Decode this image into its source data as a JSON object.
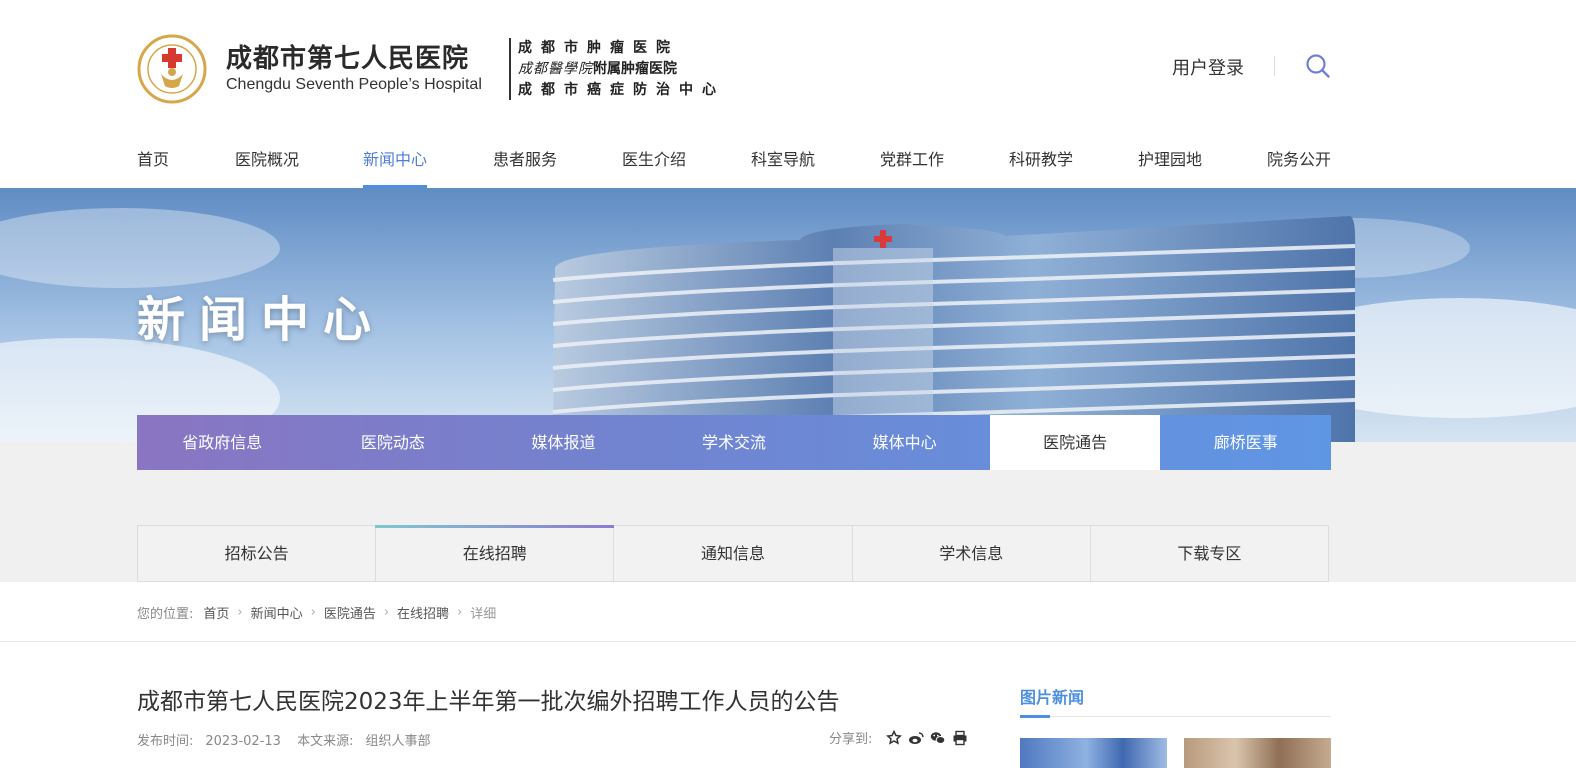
{
  "header": {
    "logo_name": "成都市第七人民医院",
    "logo_en": "Chengdu Seventh People’s Hospital",
    "logo_right_line1": "成都市肿瘤医院",
    "logo_right_line2_script": "成都醫學院",
    "logo_right_line2": "附属肿瘤医院",
    "logo_right_line3": "成都市癌症防治中心",
    "login": "用户登录"
  },
  "nav": [
    {
      "label": "首页"
    },
    {
      "label": "医院概况"
    },
    {
      "label": "新闻中心",
      "active": true
    },
    {
      "label": "患者服务"
    },
    {
      "label": "医生介绍"
    },
    {
      "label": "科室导航"
    },
    {
      "label": "党群工作"
    },
    {
      "label": "科研教学"
    },
    {
      "label": "护理园地"
    },
    {
      "label": "院务公开"
    }
  ],
  "banner": {
    "title": "新闻中心"
  },
  "section_tabs": [
    {
      "label": "省政府信息"
    },
    {
      "label": "医院动态"
    },
    {
      "label": "媒体报道"
    },
    {
      "label": "学术交流"
    },
    {
      "label": "媒体中心"
    },
    {
      "label": "医院通告",
      "active": true
    },
    {
      "label": "廊桥医事"
    }
  ],
  "sub_tabs": [
    {
      "label": "招标公告"
    },
    {
      "label": "在线招聘",
      "active": true
    },
    {
      "label": "通知信息"
    },
    {
      "label": "学术信息"
    },
    {
      "label": "下载专区"
    }
  ],
  "breadcrumb": {
    "prefix": "您的位置:",
    "items": [
      "首页",
      "新闻中心",
      "医院通告",
      "在线招聘"
    ],
    "current": "详细"
  },
  "article": {
    "title": "成都市第七人民医院2023年上半年第一批次编外招聘工作人员的公告",
    "date_label": "发布时间:",
    "date": "2023-02-13",
    "source_label": "本文来源:",
    "source": "组织人事部",
    "share_label": "分享到:"
  },
  "sidebar": {
    "title": "图片新闻"
  },
  "colors": {
    "accent": "#4f8fe0",
    "tab_gradient_start": "#8a75c2",
    "tab_gradient_end": "#5f96e4"
  }
}
